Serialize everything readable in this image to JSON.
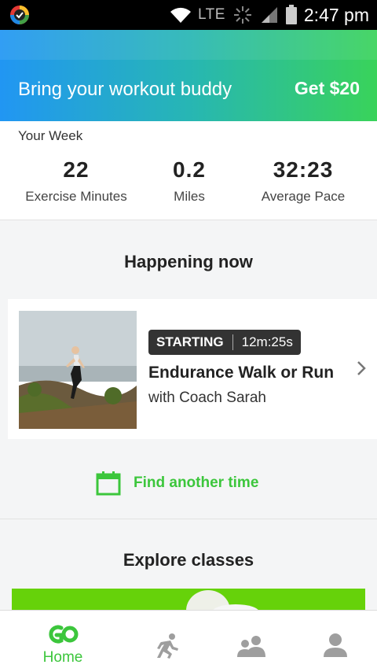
{
  "status_bar": {
    "network": "LTE",
    "time": "2:47 pm"
  },
  "banner": {
    "text": "Bring your workout buddy",
    "cta": "Get $20"
  },
  "week": {
    "title": "Your Week",
    "stats": [
      {
        "value": "22",
        "label": "Exercise Minutes"
      },
      {
        "value": "0.2",
        "label": "Miles"
      },
      {
        "value": "32:23",
        "label": "Average Pace"
      }
    ]
  },
  "happening": {
    "title": "Happening now",
    "card": {
      "status": "STARTING",
      "countdown": "12m:25s",
      "title": "Endurance Walk or Run",
      "coach": "with Coach Sarah"
    },
    "find_label": "Find another time"
  },
  "explore": {
    "title": "Explore classes"
  },
  "tabs": [
    {
      "icon": "go-logo-icon",
      "label": "Home",
      "active": true
    },
    {
      "icon": "runner-icon",
      "label": ""
    },
    {
      "icon": "group-icon",
      "label": ""
    },
    {
      "icon": "profile-icon",
      "label": ""
    }
  ],
  "colors": {
    "accent": "#3cc63c",
    "banner_start": "#2196f3",
    "banner_end": "#39d35a",
    "badge": "#333333"
  }
}
